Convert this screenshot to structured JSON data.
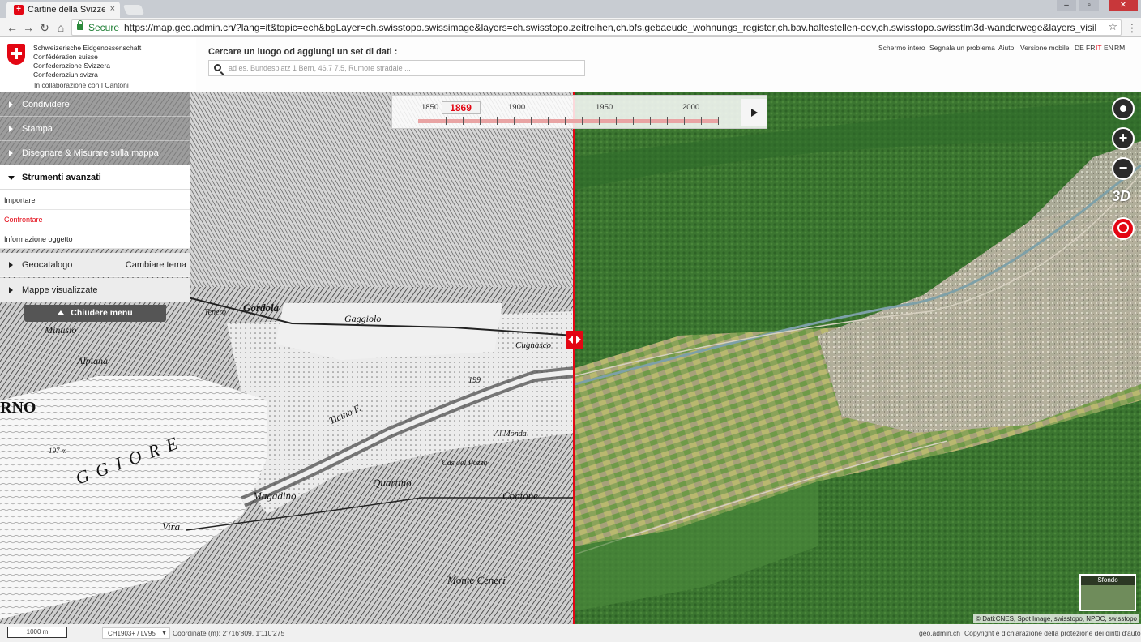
{
  "browser": {
    "tab_title": "Cartine della Svizzera - G",
    "tab_close": "×",
    "window_controls": [
      "–",
      "▫",
      "✕"
    ],
    "nav": [
      "←",
      "→",
      "↻",
      "⌂"
    ],
    "secure_label": "Secure",
    "url": "https://map.geo.admin.ch/?lang=it&topic=ech&bgLayer=ch.swisstopo.swissimage&layers=ch.swisstopo.zeitreihen,ch.bfs.gebaeude_wohnungs_register,ch.bav.haltestellen-oev,ch.swisstopo.swisstlm3d-wanderwege&layers_visibility=true,false,false,false&layers_timestan",
    "star": "☆",
    "menu": "⋮"
  },
  "brand": {
    "lines": [
      "Schweizerische Eidgenossenschaft",
      "Confédération suisse",
      "Confederazione Svizzera",
      "Confederaziun svizra"
    ],
    "sub": "In collaborazione con I Cantoni"
  },
  "search": {
    "title": "Cercare un luogo od aggiungi un set di dati :",
    "placeholder": "ad es. Bundesplatz 1 Bern, 46.7 7.5, Rumore stradale ..."
  },
  "top_links": [
    "Schermo intero",
    "Segnala un problema",
    "Aiuto",
    "Versione mobile"
  ],
  "languages": [
    "DE",
    "FR",
    "IT",
    "EN",
    "RM"
  ],
  "active_language": "IT",
  "menu": {
    "items": [
      {
        "label": "Condividere"
      },
      {
        "label": "Stampa"
      },
      {
        "label": "Disegnare & Misurare sulla mappa"
      },
      {
        "label": "Strumenti avanzati"
      }
    ],
    "tools": [
      "Importare",
      "Confrontare",
      "Informazione oggetto"
    ],
    "active_tool": "Confrontare",
    "geocatalog": {
      "label": "Geocatalogo",
      "action": "Cambiare tema"
    },
    "visible_maps": "Mappe visualizzate",
    "close": "Chiudere menu"
  },
  "timeline": {
    "labels": [
      "1850",
      "1900",
      "1950",
      "2000"
    ],
    "current": "1869",
    "range": [
      1844,
      2020
    ],
    "current_value": 1869
  },
  "map_controls": {
    "zoom_in": "+",
    "zoom_out": "−",
    "mode_3d": "3D"
  },
  "old_map_labels": [
    "Gordola",
    "Gaggiolo",
    "Minusio",
    "Magadino",
    "Quartino",
    "Contone",
    "Monte Ceneri",
    "Vira",
    "Ticino F.",
    "Al Monda",
    "Cas.del Pozzo",
    "GGIORE",
    "RNO",
    "197 m",
    "199",
    "Tenero",
    "Alpiana",
    "Cugnasco"
  ],
  "background": {
    "label": "Sfondo"
  },
  "attribution": "© Dati:CNES, Spot Image, swisstopo, NPOC, swisstopo",
  "footer": {
    "scale": "1000 m",
    "projection": "CH1903+ / LV95",
    "coord_label": "Coordinate (m):",
    "coord_value": "2'716'809, 1'110'275",
    "site": "geo.admin.ch",
    "copyright": "Copyright e dichiarazione della protezione dei diritti d'autore"
  },
  "colors": {
    "accent": "#e30613",
    "menu_bg": "#8c8c8c"
  }
}
